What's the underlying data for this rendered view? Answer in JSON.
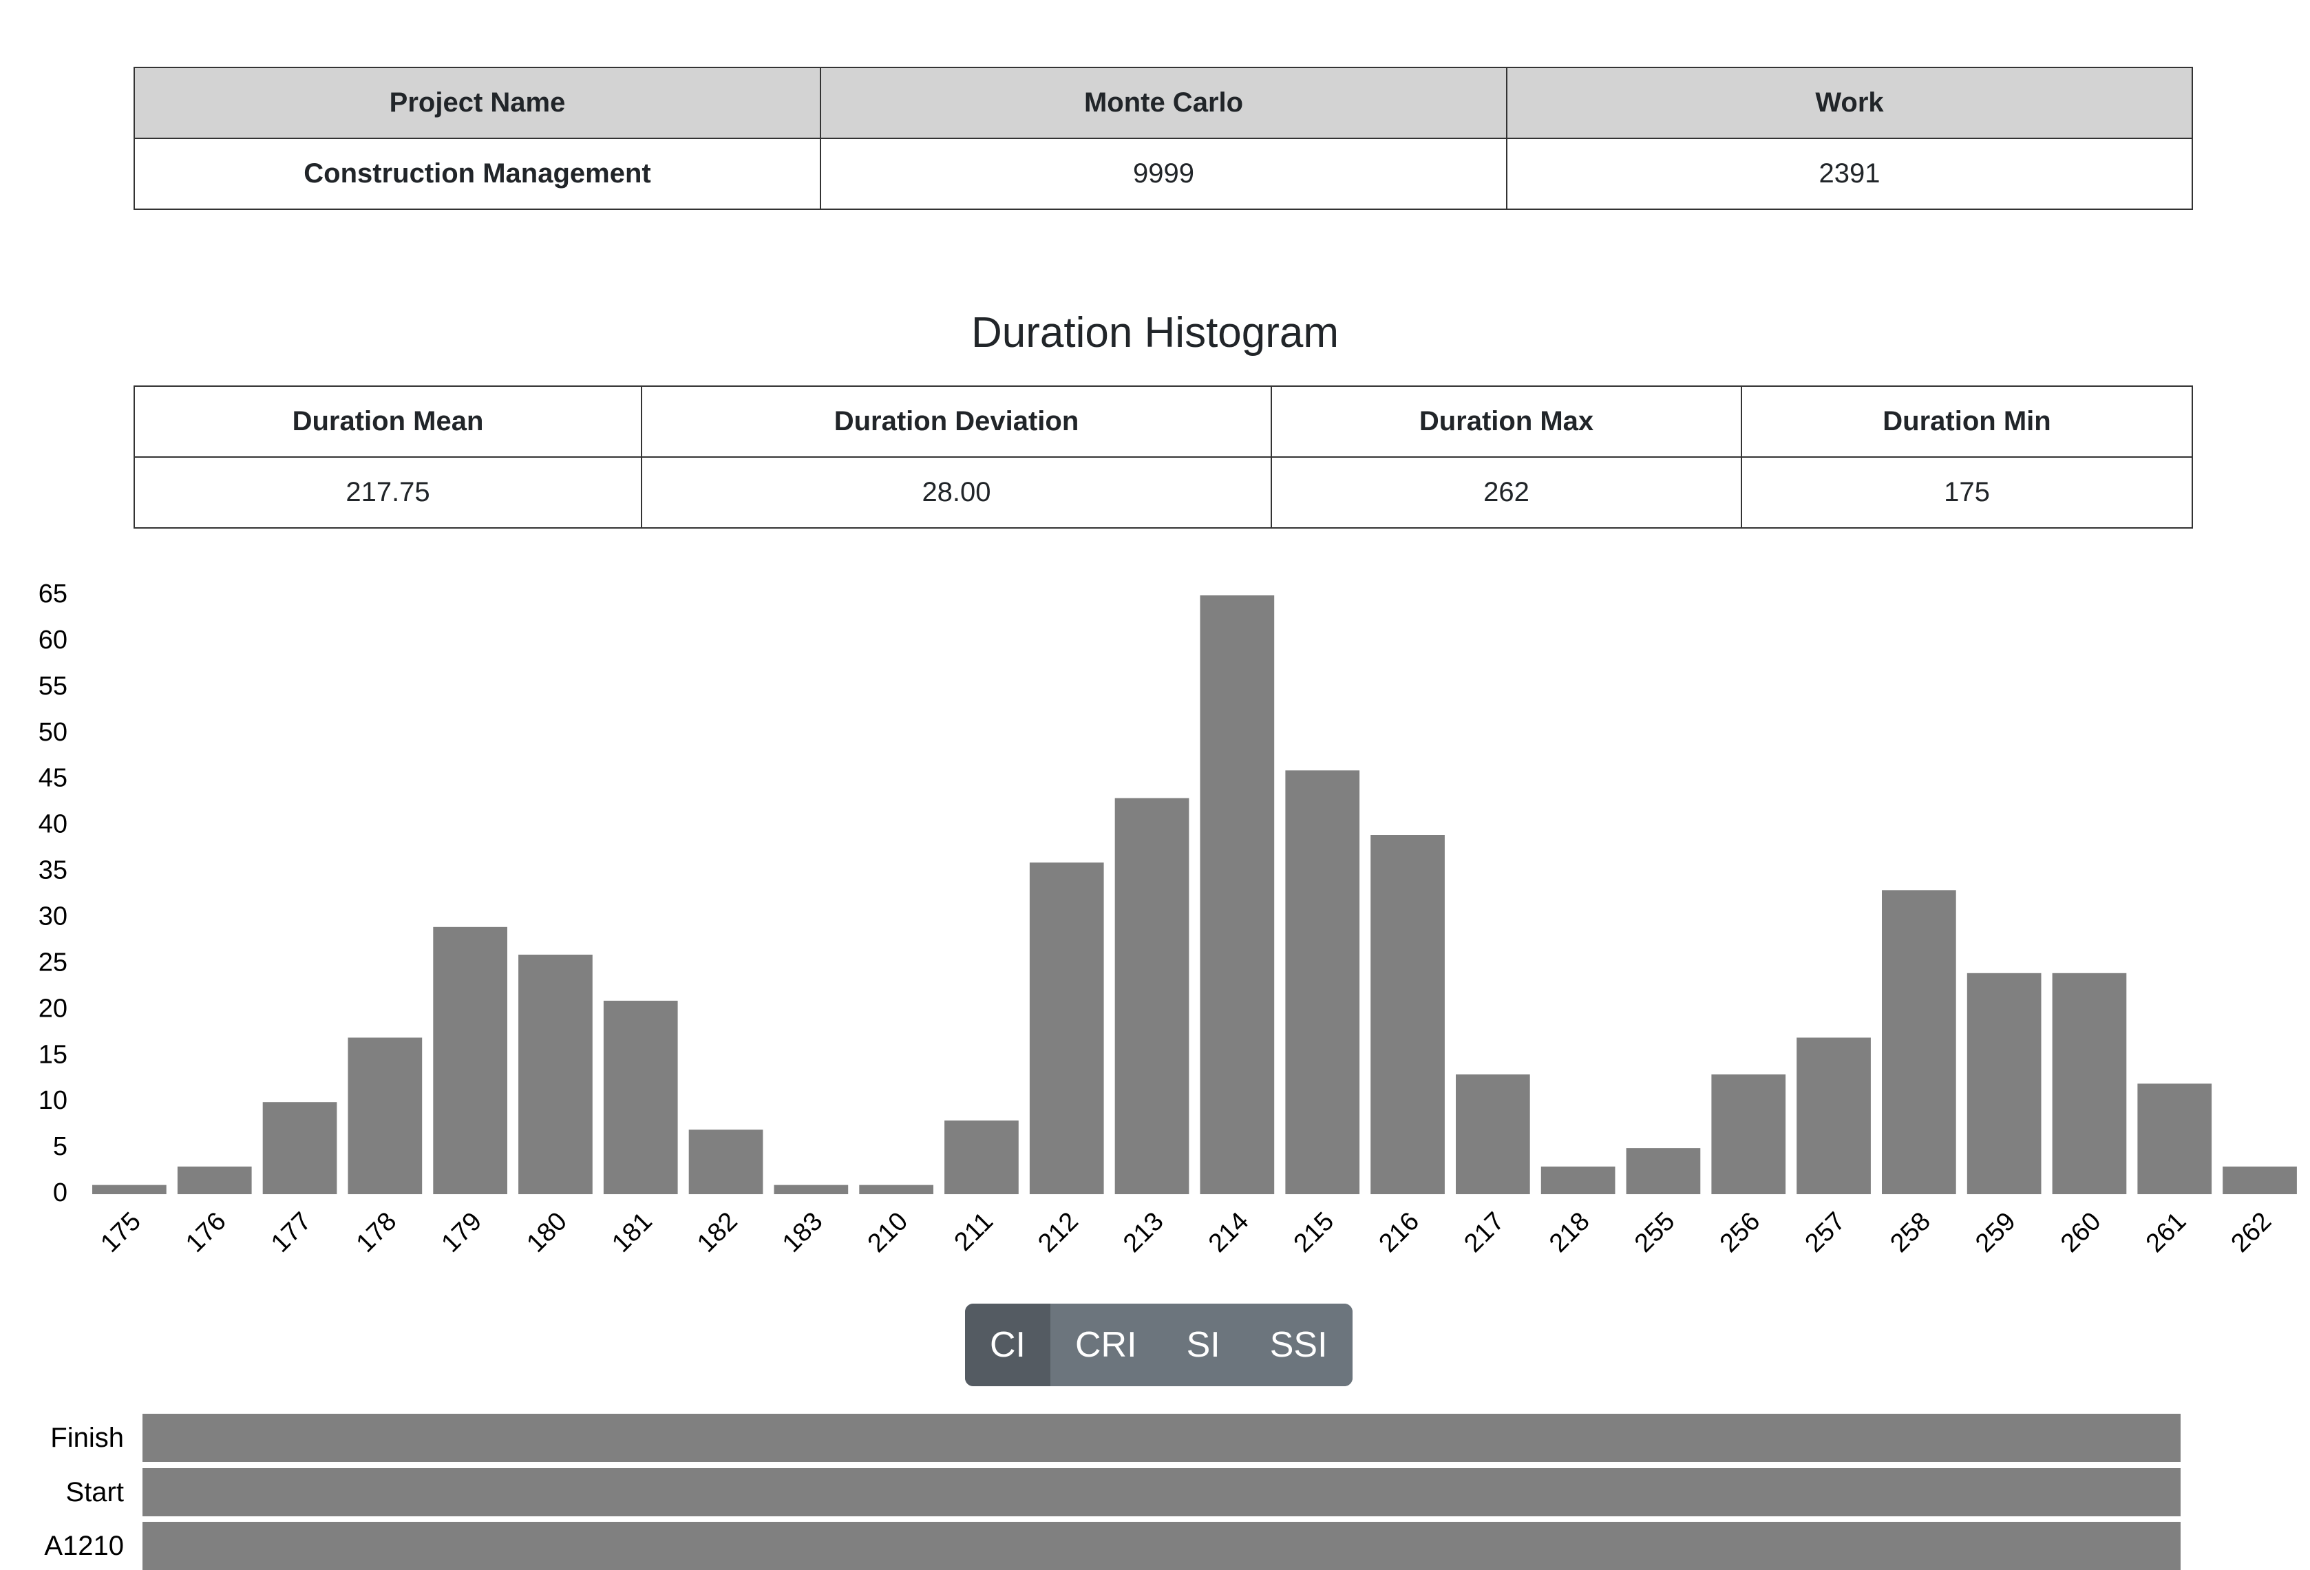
{
  "project": {
    "headers": [
      "Project Name",
      "Monte Carlo",
      "Work"
    ],
    "row": [
      "Construction Management",
      "9999",
      "2391"
    ]
  },
  "histogram_title": "Duration Histogram",
  "duration_stats": {
    "headers": [
      "Duration Mean",
      "Duration Deviation",
      "Duration Max",
      "Duration Min"
    ],
    "row": [
      "217.75",
      "28.00",
      "262",
      "175"
    ]
  },
  "chart_data": {
    "type": "bar",
    "title": "",
    "xlabel": "",
    "ylabel": "",
    "categories": [
      "175",
      "176",
      "177",
      "178",
      "179",
      "180",
      "181",
      "182",
      "183",
      "210",
      "211",
      "212",
      "213",
      "214",
      "215",
      "216",
      "217",
      "218",
      "255",
      "256",
      "257",
      "258",
      "259",
      "260",
      "261",
      "262"
    ],
    "values": [
      1,
      3,
      10,
      17,
      29,
      26,
      21,
      7,
      1,
      1,
      8,
      36,
      43,
      65,
      46,
      39,
      13,
      3,
      5,
      13,
      17,
      33,
      24,
      24,
      12,
      3
    ],
    "ylim": [
      0,
      65
    ],
    "yticks": [
      0,
      5,
      10,
      15,
      20,
      25,
      30,
      35,
      40,
      45,
      50,
      55,
      60,
      65
    ],
    "grid": false,
    "bar_color": "#808080"
  },
  "index_buttons": {
    "items": [
      "CI",
      "CRI",
      "SI",
      "SSI"
    ],
    "active": "CI"
  },
  "criticality_rows": [
    "Finish",
    "Start",
    "A1210"
  ],
  "colors": {
    "bar": "#808080",
    "header_bg": "#d3d3d3",
    "button_bg": "#6c757d",
    "button_active_bg": "#545b62"
  }
}
